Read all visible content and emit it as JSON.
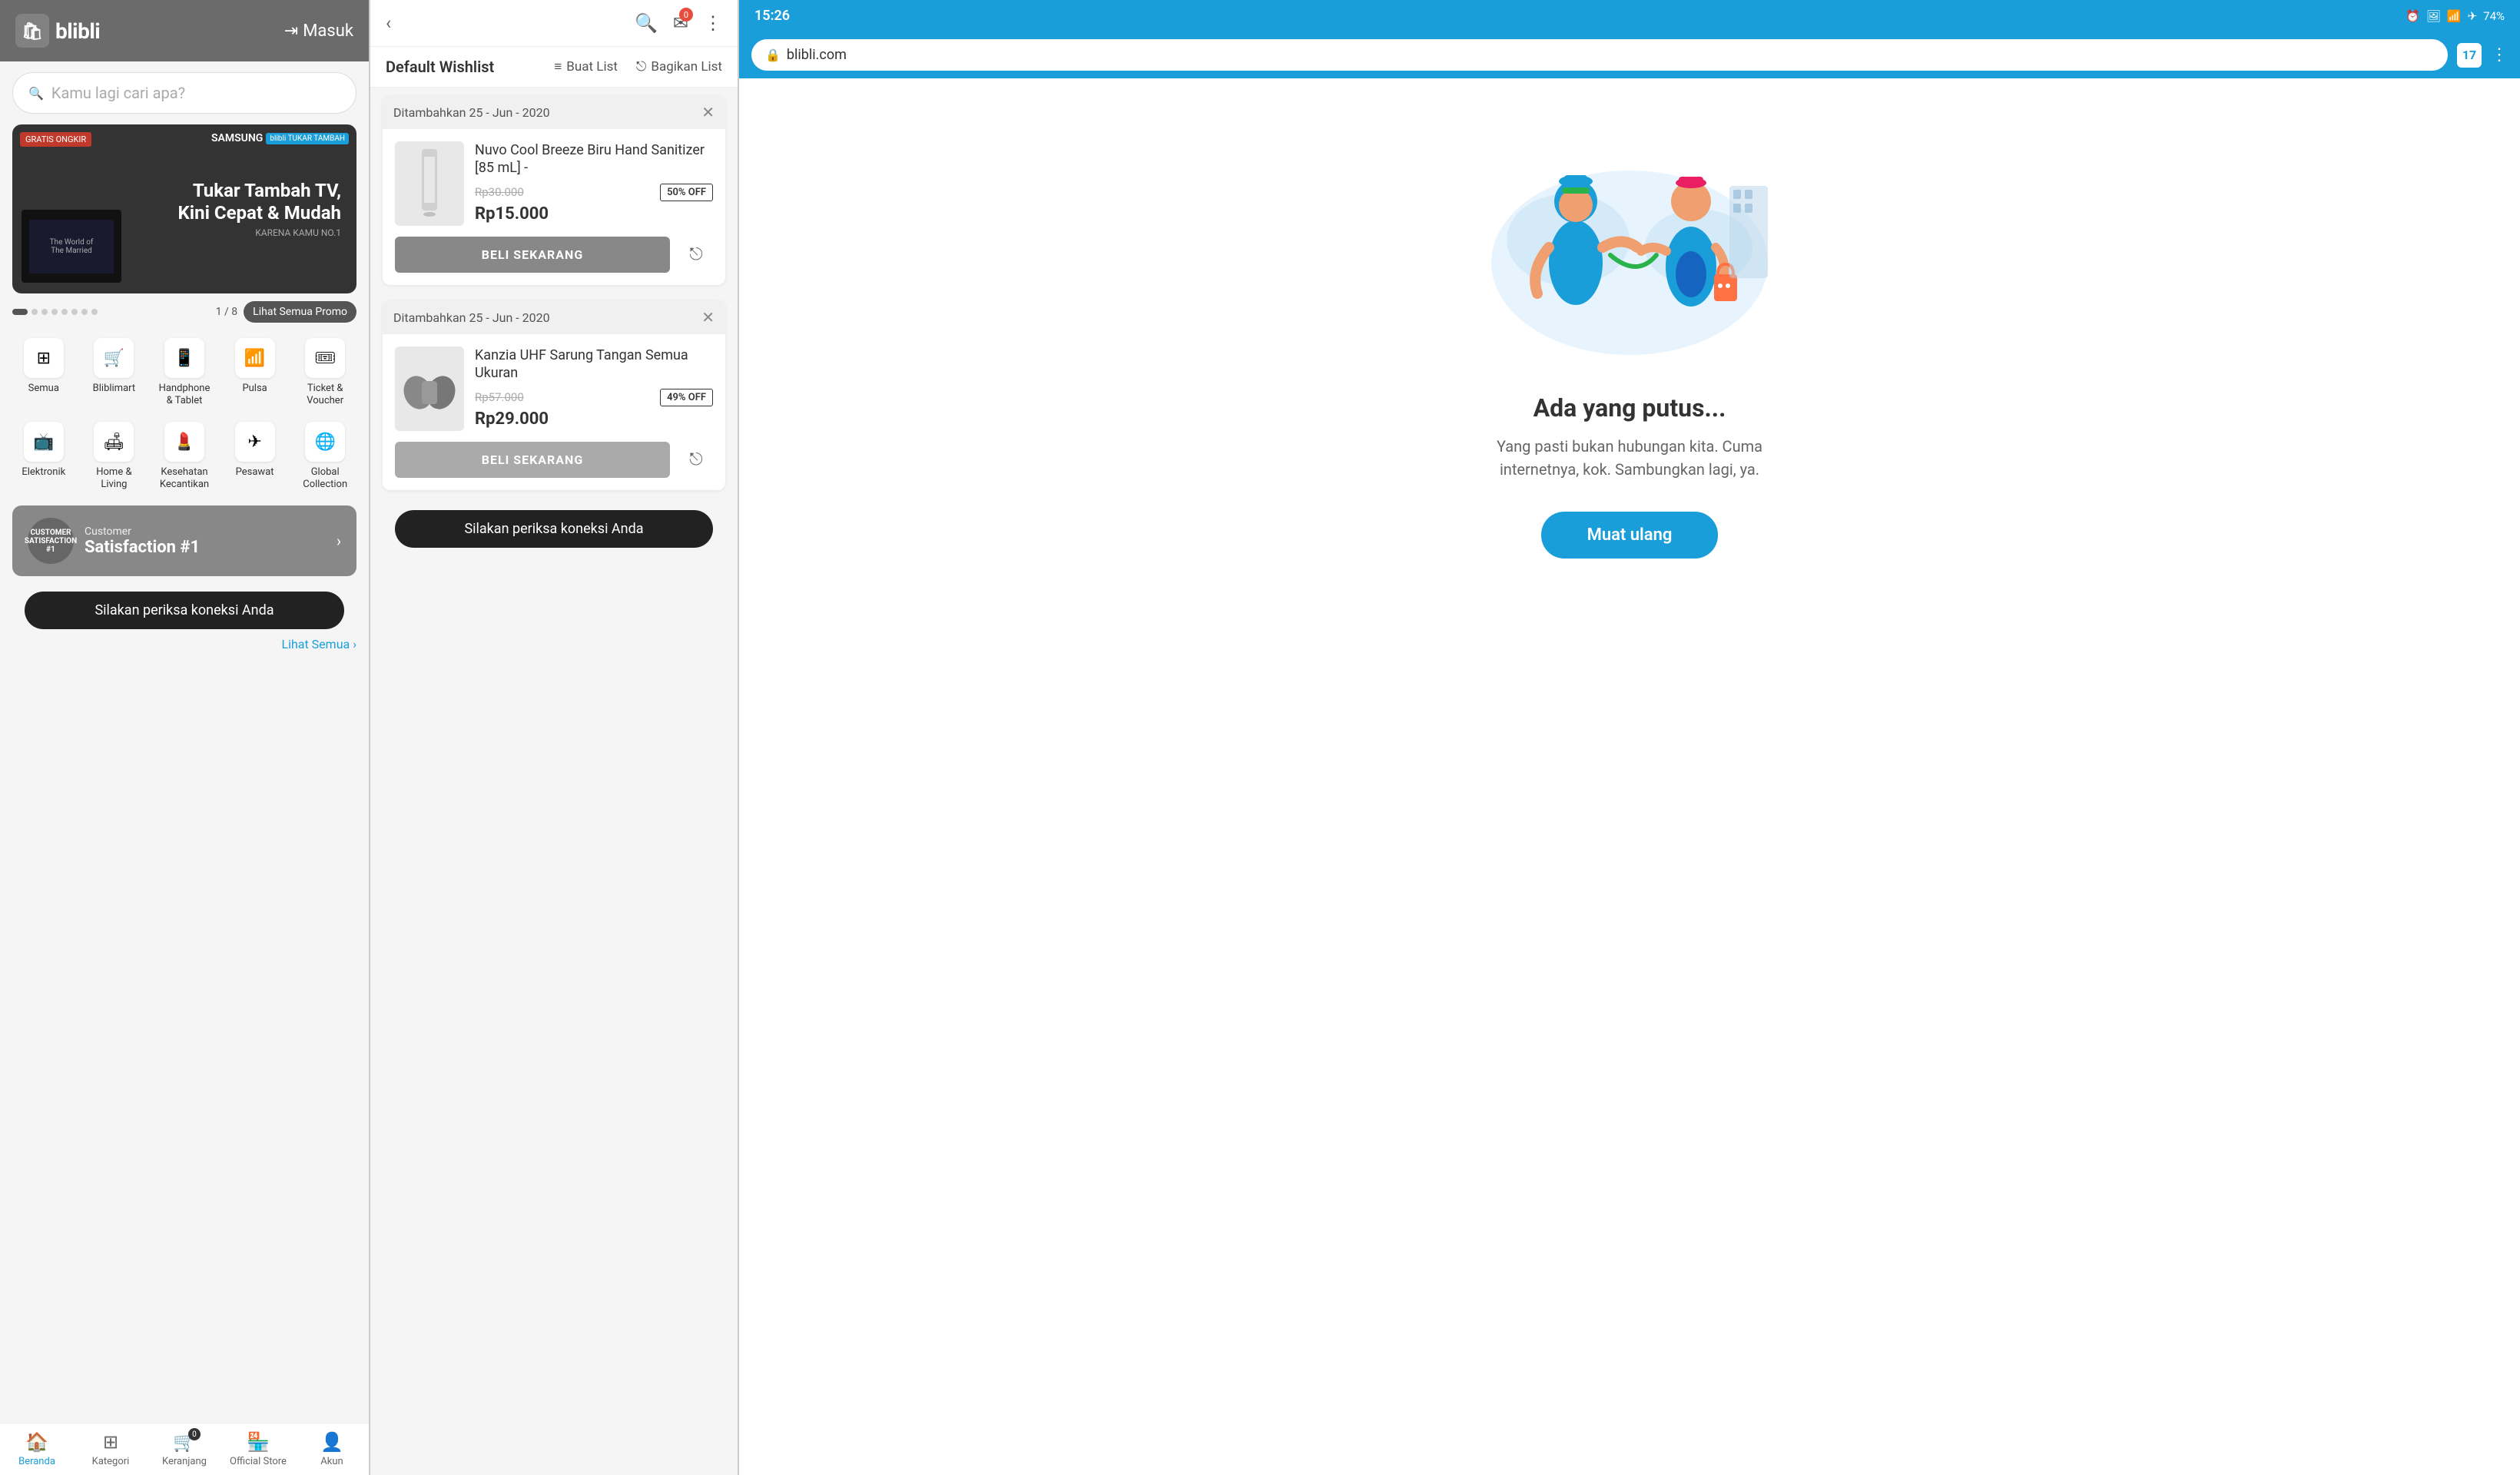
{
  "panel1": {
    "header": {
      "logo_text": "blibli",
      "login_label": "Masuk"
    },
    "search": {
      "placeholder": "Kamu lagi cari apa?"
    },
    "banner": {
      "gratis": "GRATIS ONGKIR",
      "brand": "SAMSUNG",
      "title": "Tukar Tambah TV,\nKini Cepat & Mudah",
      "subtitle": "KARENA KAMU NO.1",
      "counter": "1 / 8",
      "promo_btn": "Lihat Semua Promo"
    },
    "categories": [
      {
        "label": "Semua",
        "icon": "⊞"
      },
      {
        "label": "Bliblimart",
        "icon": "🛒"
      },
      {
        "label": "Handphone\n& Tablet",
        "icon": "📱"
      },
      {
        "label": "Pulsa",
        "icon": "📶"
      },
      {
        "label": "Ticket &\nVoucher",
        "icon": "⭐"
      },
      {
        "label": "Elektronik",
        "icon": "📺"
      },
      {
        "label": "Home &\nLiving",
        "icon": "🛋"
      },
      {
        "label": "Kesehatan\nKecantikan",
        "icon": "💄"
      },
      {
        "label": "Pesawat",
        "icon": "✈"
      },
      {
        "label": "Global\nCollection",
        "icon": "🌐"
      }
    ],
    "satisfaction": {
      "badge": "#1",
      "subtitle": "Customer",
      "title": "Satisfaction #1"
    },
    "toast": "Silakan periksa koneksi Anda",
    "bottom_nav": [
      {
        "label": "Beranda",
        "icon": "🏠"
      },
      {
        "label": "Kategori",
        "icon": "⊞"
      },
      {
        "label": "Keranjang",
        "icon": "🛒",
        "badge": "0"
      },
      {
        "label": "Official Store",
        "icon": "🏪"
      },
      {
        "label": "Akun",
        "icon": "👤"
      }
    ],
    "lihat_semua": "Lihat Semua ›"
  },
  "panel2": {
    "header_icons": {
      "search": "🔍",
      "notification": "✉",
      "notification_count": "0",
      "more": "⋮"
    },
    "wishlist_title": "Default Wishlist",
    "buat_list": "Buat List",
    "bagikan_list": "Bagikan List",
    "items": [
      {
        "date": "Ditambahkan 25 - Jun - 2020",
        "product_name": "Nuvo Cool Breeze Biru Hand Sanitizer [85 mL] -",
        "old_price": "Rp30.000",
        "discount": "50% OFF",
        "new_price": "Rp15.000",
        "buy_btn": "BELI SEKARANG",
        "emoji": "🧴"
      },
      {
        "date": "Ditambahkan 25 - Jun - 2020",
        "product_name": "Kanzia UHF Sarung Tangan Semua Ukuran",
        "old_price": "Rp57.000",
        "discount": "49% OFF",
        "new_price": "Rp29.000",
        "buy_btn": "BELI SEKARANG",
        "emoji": "🥊"
      }
    ],
    "toast": "Silakan periksa koneksi Anda"
  },
  "panel3": {
    "status_bar": {
      "time": "15:26",
      "battery": "74%"
    },
    "browser": {
      "url": "blibli.com",
      "tab_count": "17",
      "menu_icon": "⋮"
    },
    "error": {
      "title": "Ada yang putus...",
      "description": "Yang pasti bukan hubungan kita. Cuma internetnya, kok. Sambungkan lagi, ya.",
      "reload_btn": "Muat ulang"
    }
  }
}
